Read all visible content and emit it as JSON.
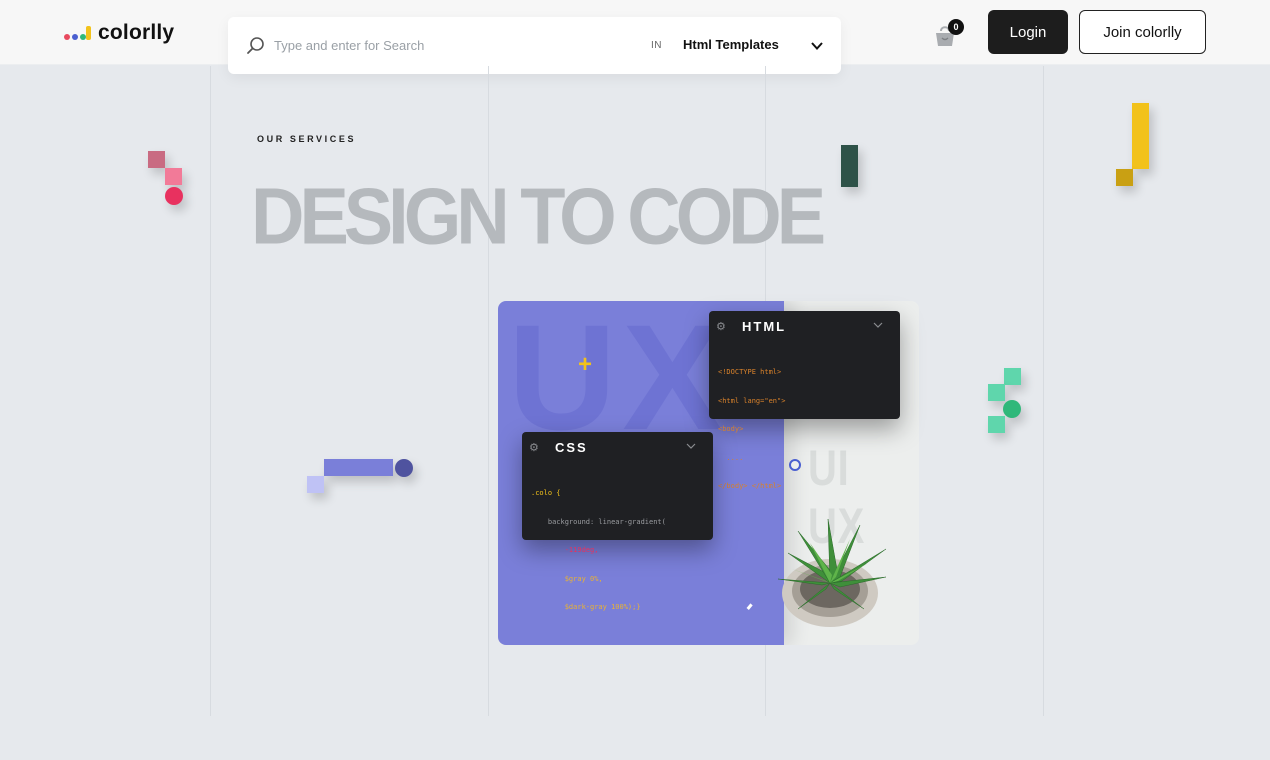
{
  "header": {
    "logo_text": "colorlly",
    "search_placeholder": "Type and enter for Search",
    "in_label": "IN",
    "category": "Html Templates",
    "cart_count": "0",
    "login_label": "Login",
    "join_label": "Join colorlly"
  },
  "hero": {
    "eyebrow": "OUR SERVICES",
    "title": "DESIGN TO CODE"
  },
  "illustration": {
    "ghost_text": "UX",
    "side_text": "UI UX",
    "html_card": {
      "title": "HTML",
      "lines": [
        "<!DOCTYPE html>",
        "<html lang=\"en\">",
        "<body>",
        "  ....",
        "</body> </html>"
      ]
    },
    "css_card": {
      "title": "CSS",
      "lines": [
        ".colo {",
        "    background: linear-gradient(",
        "        -119deg,",
        "        $gray 0%,",
        "        $dark-gray 100%);}"
      ]
    }
  },
  "colors": {
    "accent_purple": "#7a7fd9",
    "brand_yellow": "#f2c21b",
    "brand_pink": "#e84a5f",
    "brand_green": "#2fb87a",
    "title_gray": "#b5b9bd"
  },
  "icons": [
    "search-icon",
    "chevron-down-icon",
    "shopping-bag-icon",
    "gear-icon"
  ]
}
